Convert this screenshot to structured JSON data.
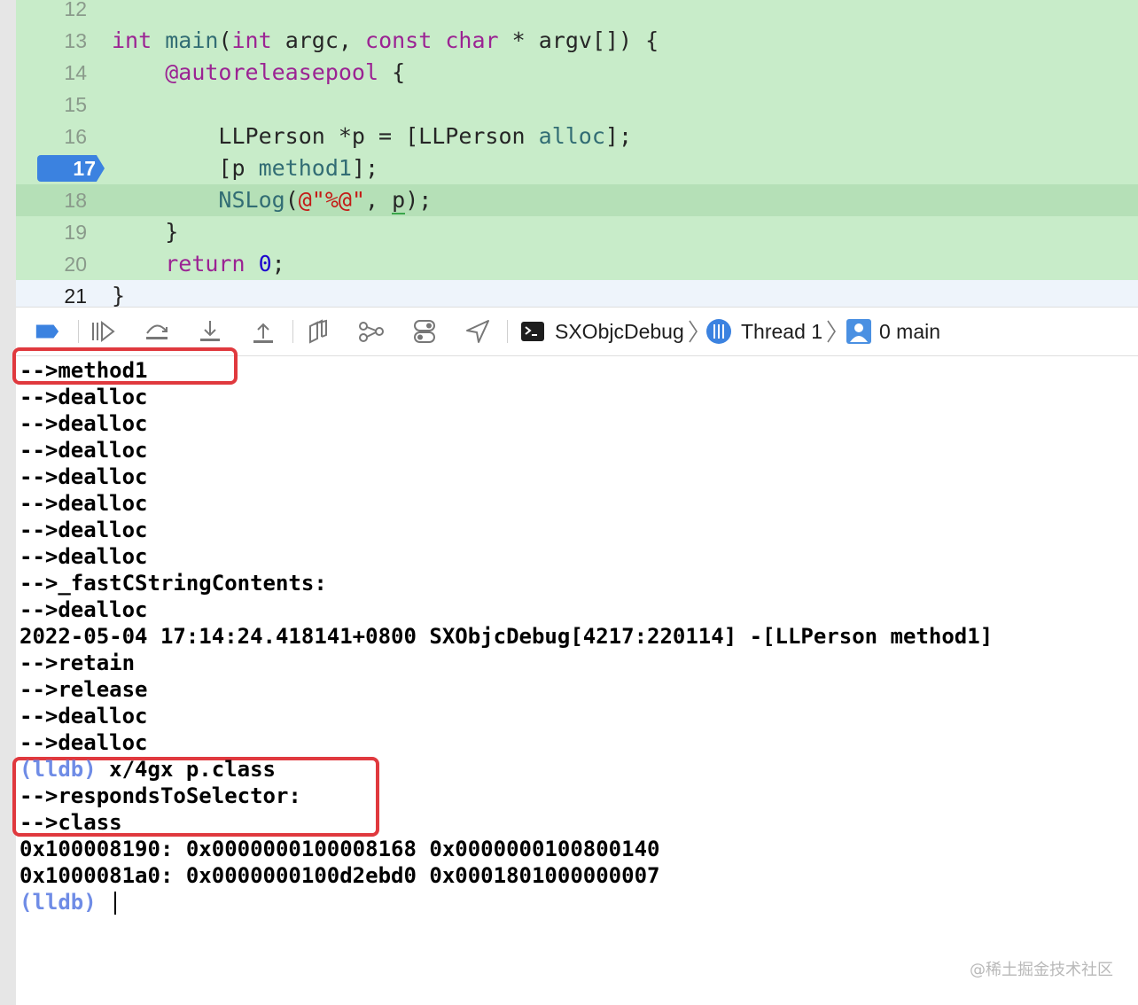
{
  "editor": {
    "lines": [
      {
        "num": "12",
        "segments": []
      },
      {
        "num": "13",
        "segments": [
          {
            "cls": "kw",
            "text": "int"
          },
          {
            "cls": "",
            "text": " "
          },
          {
            "cls": "fn",
            "text": "main"
          },
          {
            "cls": "",
            "text": "("
          },
          {
            "cls": "kw",
            "text": "int"
          },
          {
            "cls": "",
            "text": " argc, "
          },
          {
            "cls": "kw",
            "text": "const"
          },
          {
            "cls": "",
            "text": " "
          },
          {
            "cls": "kw",
            "text": "char"
          },
          {
            "cls": "",
            "text": " * argv[]) {"
          }
        ]
      },
      {
        "num": "14",
        "segments": [
          {
            "cls": "",
            "text": "    "
          },
          {
            "cls": "kw",
            "text": "@autoreleasepool"
          },
          {
            "cls": "",
            "text": " {"
          }
        ]
      },
      {
        "num": "15",
        "segments": []
      },
      {
        "num": "16",
        "segments": [
          {
            "cls": "",
            "text": "        LLPerson *p = [LLPerson "
          },
          {
            "cls": "fn",
            "text": "alloc"
          },
          {
            "cls": "",
            "text": "];"
          }
        ]
      },
      {
        "num": "17",
        "breakpoint": true,
        "segments": [
          {
            "cls": "",
            "text": "        [p "
          },
          {
            "cls": "fn",
            "text": "method1"
          },
          {
            "cls": "",
            "text": "];"
          }
        ]
      },
      {
        "num": "18",
        "current": true,
        "segments": [
          {
            "cls": "",
            "text": "        "
          },
          {
            "cls": "fn",
            "text": "NSLog"
          },
          {
            "cls": "",
            "text": "("
          },
          {
            "cls": "str",
            "text": "@\"%@\""
          },
          {
            "cls": "",
            "text": ", "
          },
          {
            "cls": "err-underline",
            "text": "p"
          },
          {
            "cls": "",
            "text": ");"
          }
        ]
      },
      {
        "num": "19",
        "segments": [
          {
            "cls": "",
            "text": "    }"
          }
        ]
      },
      {
        "num": "20",
        "segments": [
          {
            "cls": "",
            "text": "    "
          },
          {
            "cls": "kw",
            "text": "return"
          },
          {
            "cls": "",
            "text": " "
          },
          {
            "cls": "num",
            "text": "0"
          },
          {
            "cls": "",
            "text": ";"
          }
        ]
      },
      {
        "num": "21",
        "last": true,
        "segments": [
          {
            "cls": "",
            "text": "}"
          }
        ]
      }
    ]
  },
  "debugbar": {
    "target": "SXObjcDebug",
    "thread": "Thread 1",
    "frame": "0 main",
    "icons": [
      "breakpoints-toggle-icon",
      "continue-icon",
      "step-over-icon",
      "step-into-icon",
      "step-out-icon",
      "view-hierarchy-icon",
      "memory-graph-icon",
      "environment-overrides-icon",
      "simulate-location-icon"
    ]
  },
  "console": {
    "lines": [
      "-->method1",
      "-->dealloc",
      "-->dealloc",
      "-->dealloc",
      "-->dealloc",
      "-->dealloc",
      "-->dealloc",
      "-->dealloc",
      "-->_fastCStringContents:",
      "-->dealloc",
      "2022-05-04 17:14:24.418141+0800 SXObjcDebug[4217:220114] -[LLPerson method1]",
      "-->retain",
      "-->release",
      "-->dealloc",
      "-->dealloc",
      {
        "prompt": "(lldb)",
        "text": " x/4gx p.class"
      },
      "-->respondsToSelector:",
      "-->class",
      "0x100008190: 0x0000000100008168 0x0000000100800140",
      "0x1000081a0: 0x0000000100d2ebd0 0x0001801000000007",
      {
        "prompt": "(lldb)",
        "text": " ",
        "caret": true
      }
    ],
    "highlight_color": "#e0393e"
  },
  "watermark": "@稀土掘金技术社区"
}
